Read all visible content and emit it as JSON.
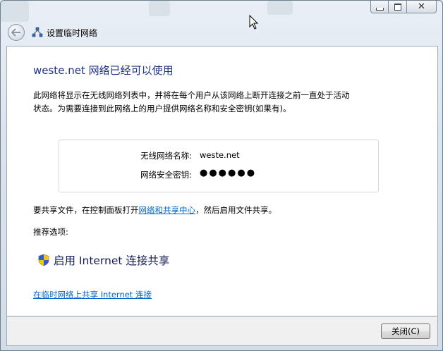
{
  "window": {
    "title": "设置临时网络",
    "controls": {
      "minimize": "minimize-icon",
      "maximize": "maximize-icon",
      "close": "close-icon"
    }
  },
  "content": {
    "heading": "weste.net 网络已经可以使用",
    "description_line1": "此网络将显示在无线网络列表中，并将在每个用户从该网络上断开连接之前一直处于活动",
    "description_line2": "状态。为需要连接到此网络上的用户提供网络名称和安全密钥(如果有)。",
    "info": {
      "name_label": "无线网络名称:",
      "name_value": "weste.net",
      "key_label": "网络安全密钥:",
      "key_value": "●●●●●●"
    },
    "share": {
      "prefix": "要共享文件，在控制面板打开",
      "link": "网络和共享中心",
      "suffix": "，然后启用文件共享。"
    },
    "recommended_label": "推荐选项:",
    "option_label": "启用 Internet 连接共享",
    "bottom_link": "在临时网络上共享 Internet 连接"
  },
  "footer": {
    "close_button": "关闭(C)"
  },
  "colors": {
    "heading": "#1e3287",
    "link": "#0066cc",
    "option": "#151c55"
  }
}
